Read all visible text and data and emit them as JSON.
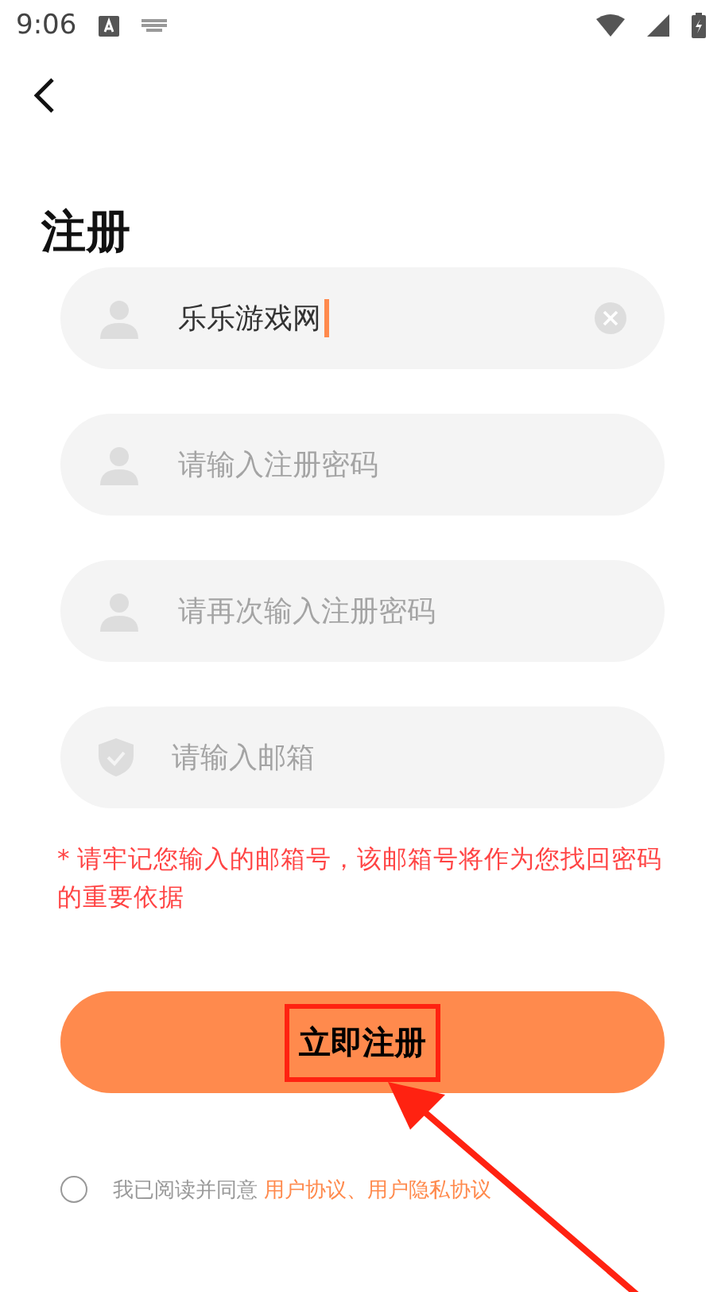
{
  "status_bar": {
    "time": "9:06"
  },
  "title": "注册",
  "fields": [
    {
      "kind": "user",
      "value": "乐乐游戏网",
      "focused": true,
      "clearable": true
    },
    {
      "kind": "user",
      "placeholder": "请输入注册密码",
      "focused": false,
      "clearable": false
    },
    {
      "kind": "user",
      "placeholder": "请再次输入注册密码",
      "focused": false,
      "clearable": false
    },
    {
      "kind": "email",
      "placeholder": "请输入邮箱",
      "focused": false,
      "clearable": false
    }
  ],
  "warning": "* 请牢记您输入的邮箱号，该邮箱号将作为您找回密码的重要依据",
  "submit_button": {
    "label": "立即注册",
    "highlighted": true
  },
  "agreement": {
    "checked": false,
    "text": "我已阅读并同意",
    "link": "用户协议、用户隐私协议"
  }
}
